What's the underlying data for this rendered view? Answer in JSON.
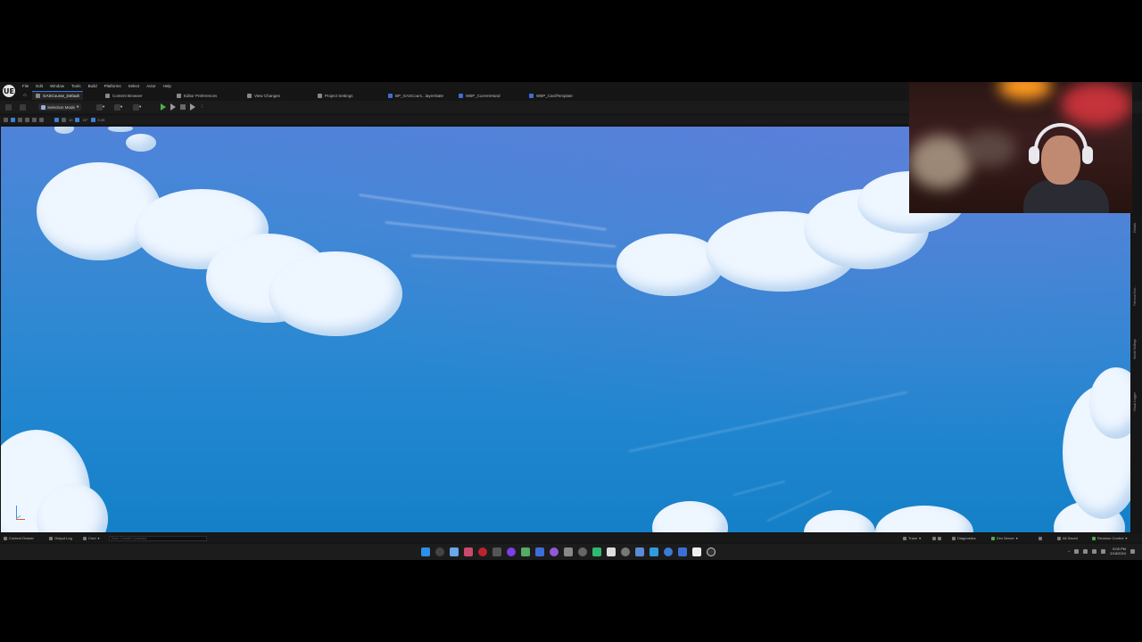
{
  "editor": {
    "logo": "UE",
    "menus": [
      "File",
      "Edit",
      "Window",
      "Tools",
      "Build",
      "Platforms",
      "Select",
      "Actor",
      "Help"
    ],
    "tabs": [
      {
        "label": "GASCourse_Default",
        "icon": "level-icon",
        "active": true
      },
      {
        "label": "Content Browser",
        "icon": "folder-icon",
        "active": false
      },
      {
        "label": "Editor Preferences",
        "icon": "settings-icon",
        "active": false
      },
      {
        "label": "View Changes",
        "icon": "changes-icon",
        "active": false
      },
      {
        "label": "Project Settings",
        "icon": "gear-icon",
        "active": false
      },
      {
        "label": "BP_GASCours...layerState",
        "icon": "blueprint-icon",
        "active": false
      },
      {
        "label": "WBP_CurrentHand",
        "icon": "widget-blueprint-icon",
        "active": false
      },
      {
        "label": "WBP_CardTemplate",
        "icon": "widget-blueprint-icon",
        "active": false
      }
    ],
    "toolbar": {
      "selection_mode": "Selection Mode"
    },
    "viewport_toolbar": {
      "grid": "10",
      "rotation": "10°",
      "scale": "0.25"
    },
    "side_panels": [
      "Details",
      "Thermal Ove...",
      "World Settings",
      "Visual Logger"
    ]
  },
  "statusbar": {
    "content_drawer": "Content Drawer",
    "output_log": "Output Log",
    "cmd": "Cmd",
    "cmd_placeholder": "Enter Console Command",
    "trace": "Trace",
    "derived_data": "Diagnostics",
    "zen_server": "Zen Server",
    "all_saved": "All Saved",
    "revision_control": "Revision Control"
  },
  "taskbar": {
    "time": "9:05 PM",
    "date": "2/18/2024"
  },
  "colors": {
    "sky_top": "#4f83d9",
    "sky_bottom": "#1480c7",
    "accent": "#2f7bd9",
    "play_green": "#4cae4c"
  }
}
